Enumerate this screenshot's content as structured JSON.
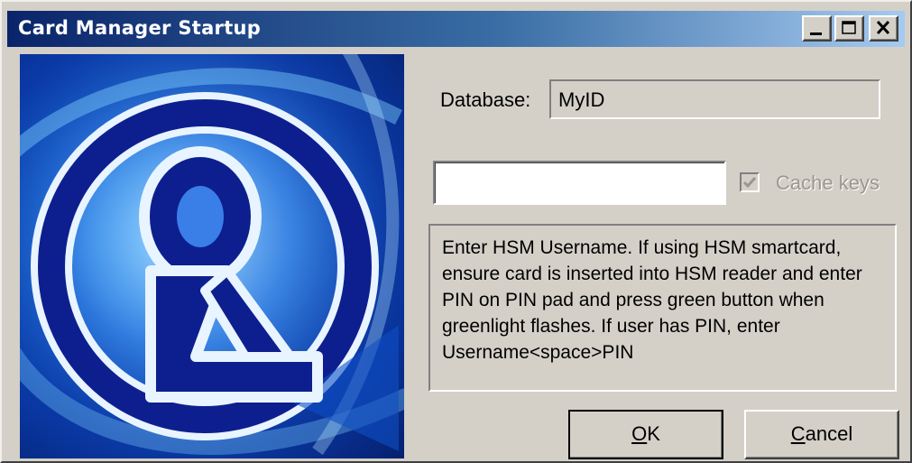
{
  "window": {
    "title": "Card Manager Startup",
    "controls": [
      "minimize-icon",
      "maximize-icon",
      "close-icon"
    ]
  },
  "form": {
    "database_label": "Database:",
    "database_value": "MyID",
    "username_value": "",
    "cache_keys_label": "Cache keys",
    "cache_keys_checked": true,
    "cache_keys_enabled": false,
    "instructions": "Enter HSM Username. If using HSM smartcard, ensure card is inserted into HSM reader and enter PIN on PIN pad and press green button when greenlight flashes. If user has PIN, enter Username<space>PIN"
  },
  "buttons": {
    "ok": {
      "mnemonic": "O",
      "rest": "K"
    },
    "cancel": {
      "mnemonic": "C",
      "rest": "ancel"
    }
  },
  "colors": {
    "title_bar_start": "#0a246a",
    "title_bar_end": "#a6caf0",
    "dialog_face": "#d4d0c8",
    "disabled_text": "#9a978f"
  }
}
